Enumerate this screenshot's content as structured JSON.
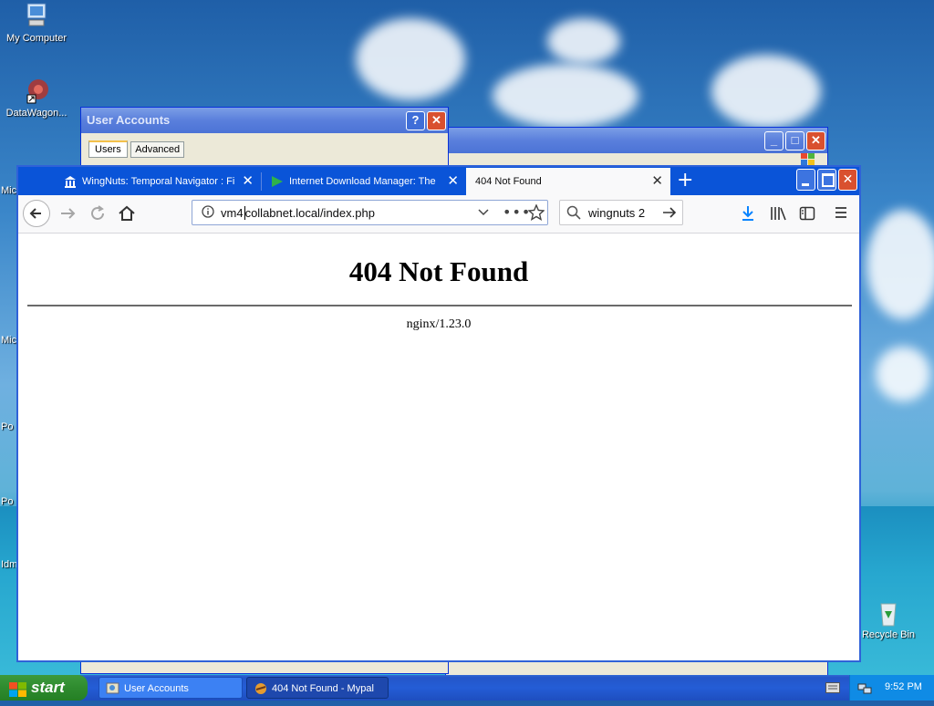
{
  "desktop": {
    "icons": [
      {
        "label": "My Computer"
      },
      {
        "label": "DataWagon..."
      },
      {
        "label": "Recycle Bin"
      }
    ],
    "edge_labels": [
      "Mic",
      "Mic",
      "Po",
      "Po",
      "Idm"
    ]
  },
  "user_accounts_window": {
    "title": "User Accounts",
    "tabs": [
      "Users",
      "Advanced"
    ],
    "help_label": "?",
    "close_label": "✕"
  },
  "browser": {
    "tabs": [
      {
        "title": "WingNuts: Temporal Navigator : Fi",
        "icon": "museum-icon"
      },
      {
        "title": "Internet Download Manager: The",
        "icon": "idm-arrow-icon"
      },
      {
        "title": "404 Not Found",
        "active": true
      }
    ],
    "new_tab_label": "+",
    "url_prefix": "vm4",
    "url_rest": "collabnet.local/index.php",
    "search_value": "wingnuts 2",
    "page": {
      "heading": "404 Not Found",
      "server": "nginx/1.23.0"
    }
  },
  "taskbar": {
    "start_label": "start",
    "items": [
      {
        "label": "User Accounts"
      },
      {
        "label": "404 Not Found - Mypal"
      }
    ],
    "clock": "9:52 PM"
  },
  "colors": {
    "xp_blue": "#0a54d8",
    "start_green": "#2f8b2f"
  }
}
